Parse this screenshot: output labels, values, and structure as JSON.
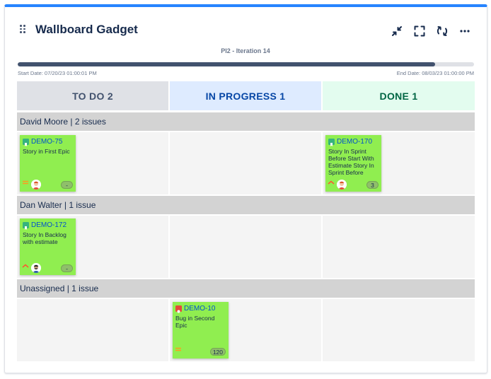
{
  "gadget": {
    "title": "Wallboard Gadget",
    "icons": [
      "drag-handle-icon",
      "collapse-icon",
      "fullscreen-icon",
      "refresh-icon",
      "more-icon"
    ]
  },
  "sprint": {
    "name": "PI2 - Iteration 14",
    "start": "Start Date: 07/20/23 01:00:01 PM",
    "end": "End Date: 08/03/23 01:00:00 PM",
    "progress": 0.915
  },
  "columns": [
    {
      "label": "TO DO 2",
      "bg": "#dfe1e6",
      "color": "#42526e"
    },
    {
      "label": "IN PROGRESS 1",
      "bg": "#deebff",
      "color": "#0747a6"
    },
    {
      "label": "DONE 1",
      "bg": "#e3fcef",
      "color": "#006644"
    }
  ],
  "swimlanes": [
    {
      "label": "David Moore | 2 issues"
    },
    {
      "label": "Dan Walter | 1 issue"
    },
    {
      "label": "Unassigned | 1 issue"
    }
  ],
  "cards": [
    {
      "key": "DEMO-75",
      "summary": "Story in First Epic",
      "points": "-",
      "type": "story",
      "priority": "medium",
      "avatar": "male-avatar-icon"
    },
    {
      "key": "DEMO-170",
      "summary": "Story In Sprint Before Start With Estimate Story In Sprint Before",
      "points": "3",
      "type": "story",
      "priority": "high",
      "avatar": "male-avatar-icon"
    },
    {
      "key": "DEMO-172",
      "summary": "Story In Backlog with estimate",
      "points": "-",
      "type": "story",
      "priority": "high",
      "avatar": "male-avatar-dark-icon"
    },
    {
      "key": "DEMO-10",
      "summary": "Bug in Second Epic",
      "points": "120",
      "type": "bug",
      "priority": "medium",
      "avatar": ""
    }
  ],
  "colors": {
    "accent": "#2684ff",
    "card": "#90ee50",
    "story": "#36b37e",
    "bug": "#e5493a",
    "priority_medium": "#ff991f",
    "priority_high": "#ff5630"
  }
}
